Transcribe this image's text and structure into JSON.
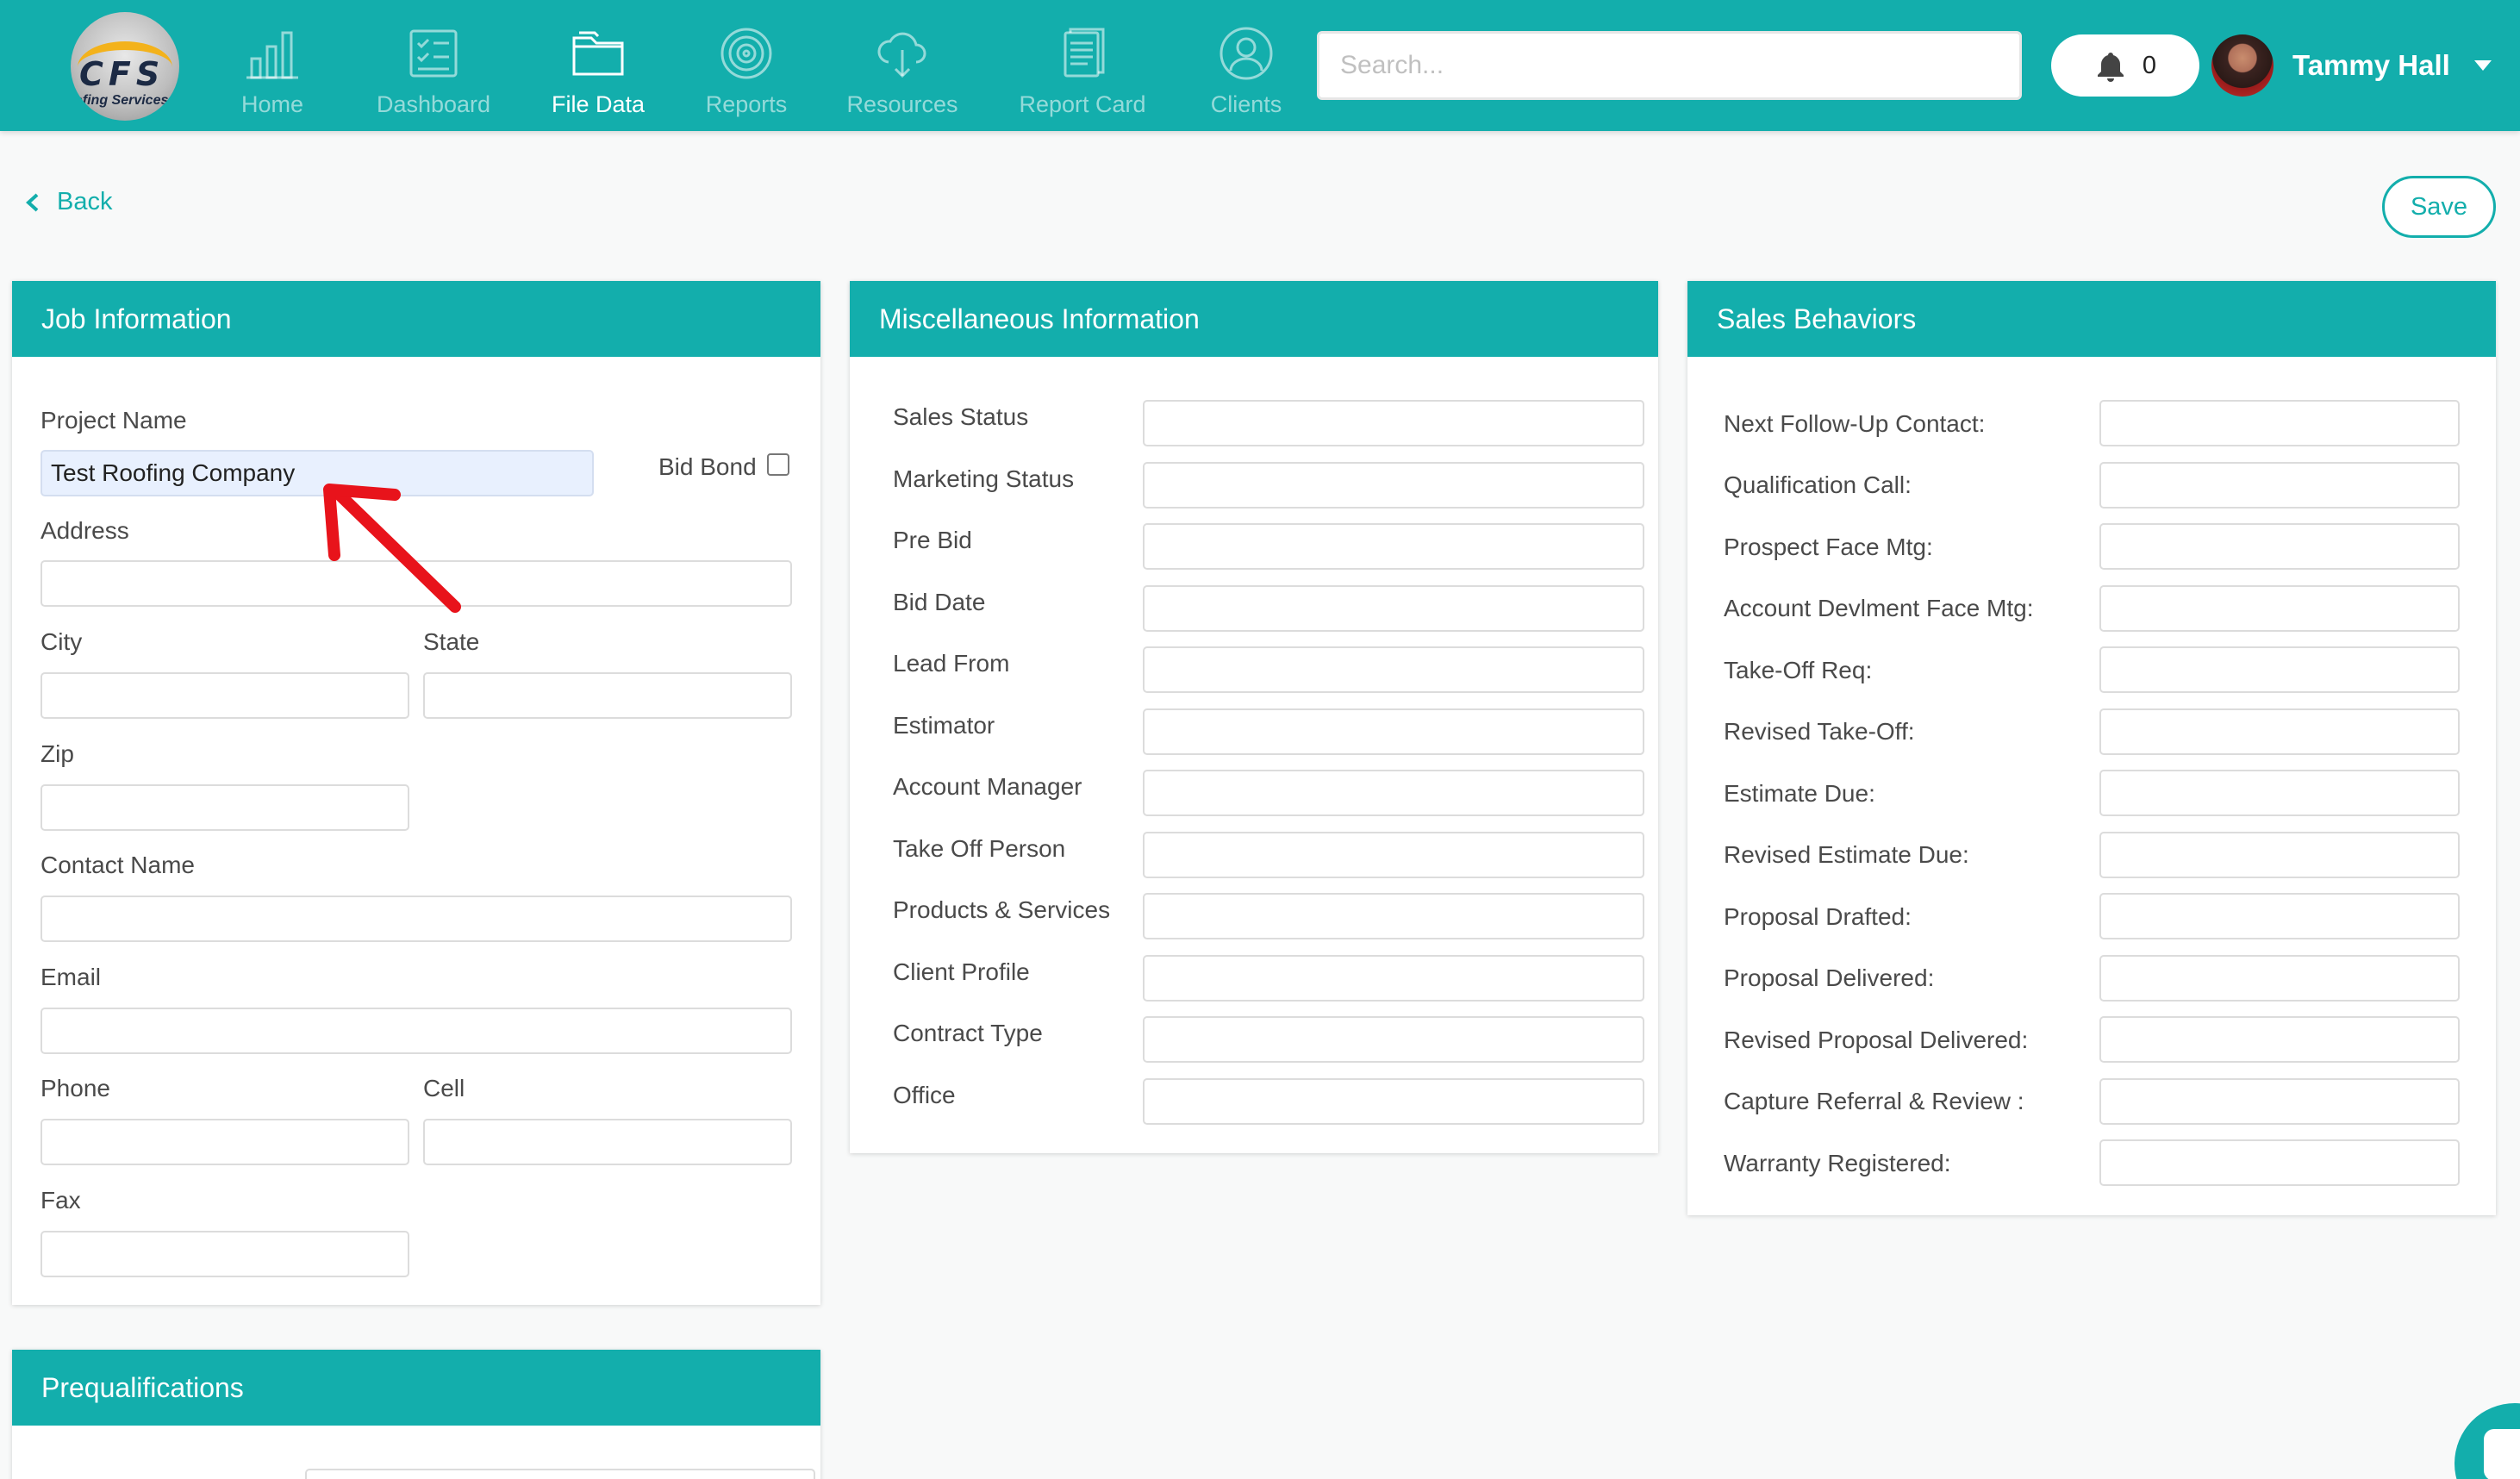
{
  "nav": {
    "logo_text": "CFS",
    "logo_sub": "ofing Services",
    "items": [
      {
        "label": "Home",
        "icon": "bar-chart-icon"
      },
      {
        "label": "Dashboard",
        "icon": "checklist-icon"
      },
      {
        "label": "File Data",
        "icon": "folder-icon",
        "active": true
      },
      {
        "label": "Reports",
        "icon": "target-icon"
      },
      {
        "label": "Resources",
        "icon": "cloud-download-icon"
      },
      {
        "label": "Report Card",
        "icon": "document-icon"
      },
      {
        "label": "Clients",
        "icon": "user-icon"
      }
    ],
    "search_placeholder": "Search...",
    "notification_count": "0",
    "user_name": "Tammy Hall"
  },
  "actions": {
    "back_label": "Back",
    "save_label": "Save"
  },
  "job": {
    "title": "Job Information",
    "project_name_label": "Project Name",
    "project_name_value": "Test Roofing Company",
    "bid_bond_label": "Bid Bond",
    "address_label": "Address",
    "city_label": "City",
    "state_label": "State",
    "zip_label": "Zip",
    "contact_name_label": "Contact Name",
    "email_label": "Email",
    "phone_label": "Phone",
    "cell_label": "Cell",
    "fax_label": "Fax"
  },
  "misc": {
    "title": "Miscellaneous Information",
    "fields": [
      "Sales Status",
      "Marketing Status",
      "Pre Bid",
      "Bid Date",
      "Lead From",
      "Estimator",
      "Account Manager",
      "Take Off Person",
      "Products & Services",
      "Client Profile",
      "Contract Type",
      "Office"
    ]
  },
  "sales": {
    "title": "Sales Behaviors",
    "fields": [
      "Next Follow-Up Contact:",
      "Qualification Call:",
      "Prospect Face Mtg:",
      "Account Devlment Face Mtg:",
      "Take-Off Req:",
      "Revised Take-Off:",
      "Estimate Due:",
      "Revised Estimate Due:",
      "Proposal Drafted:",
      "Proposal Delivered:",
      "Revised Proposal Delivered:",
      "Capture Referral & Review :",
      "Warranty Registered:"
    ]
  },
  "prequal": {
    "title": "Prequalifications"
  },
  "colors": {
    "accent": "#13aeac",
    "annotation_arrow": "#e8131b"
  }
}
